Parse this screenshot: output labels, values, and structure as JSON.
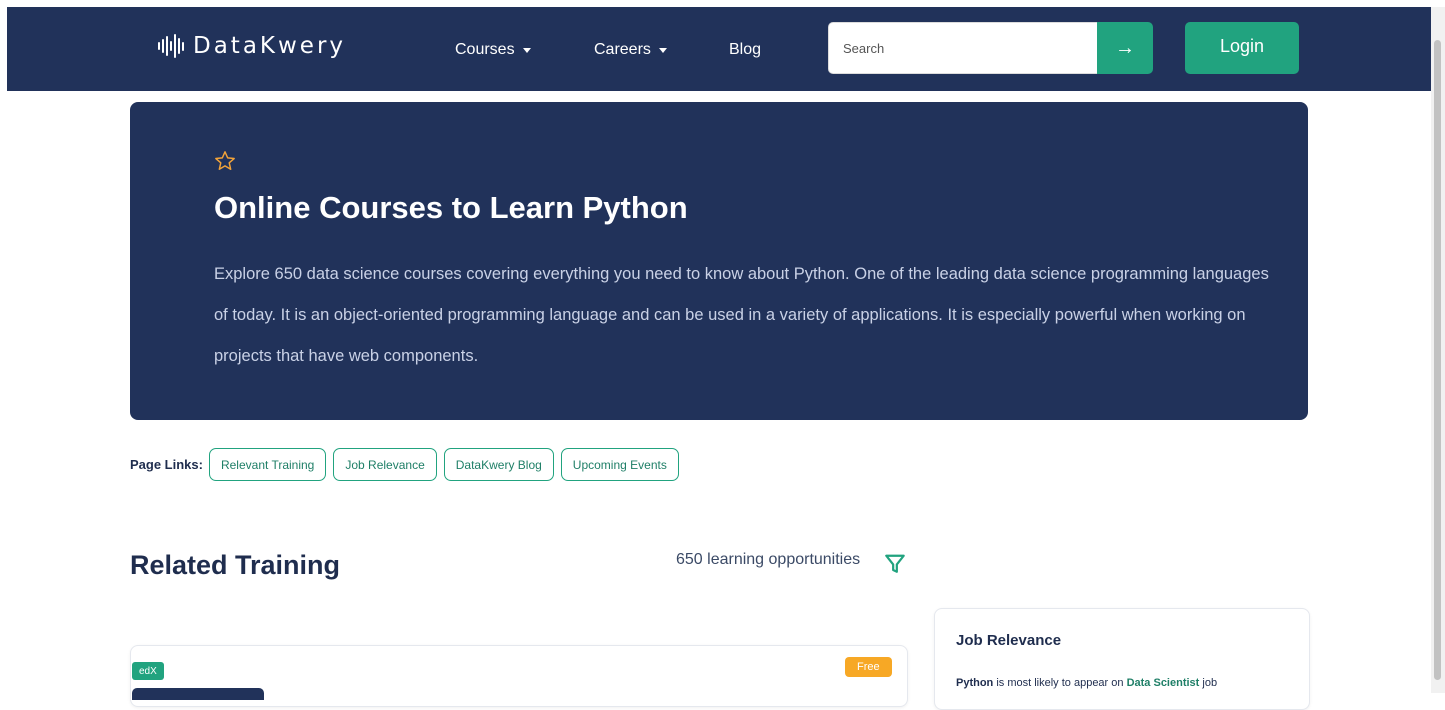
{
  "colors": {
    "navy": "#21325a",
    "accent_green": "#21a37f",
    "free_orange": "#f7a825",
    "star_orange": "#f2a33a"
  },
  "header": {
    "brand": "DataKwery",
    "logo_icon": "sound-wave-icon",
    "nav": {
      "courses": "Courses",
      "careers": "Careers",
      "blog": "Blog"
    },
    "search": {
      "placeholder": "Search",
      "submit_icon": "arrow-right-icon",
      "submit_glyph": "→"
    },
    "login": "Login"
  },
  "hero": {
    "icon": "star-outline-icon",
    "title": "Online Courses to Learn Python",
    "description": "Explore 650 data science courses covering everything you need to know about Python. One of the leading data science programming languages of today. It is an object-oriented programming language and can be used in a variety of applications. It is especially powerful when working on projects that have web components."
  },
  "page_links": {
    "label": "Page Links:",
    "items": [
      "Relevant Training",
      "Job Relevance",
      "DataKwery Blog",
      "Upcoming Events"
    ]
  },
  "training": {
    "title": "Related Training",
    "count_text": "650 learning opportunities",
    "filter_icon": "filter-icon",
    "card": {
      "provider": "edX",
      "price_badge": "Free"
    }
  },
  "job_relevance": {
    "title": "Job Relevance",
    "subject": "Python",
    "text_before": " is most likely to appear on ",
    "role": "Data Scientist",
    "text_after": " job"
  }
}
